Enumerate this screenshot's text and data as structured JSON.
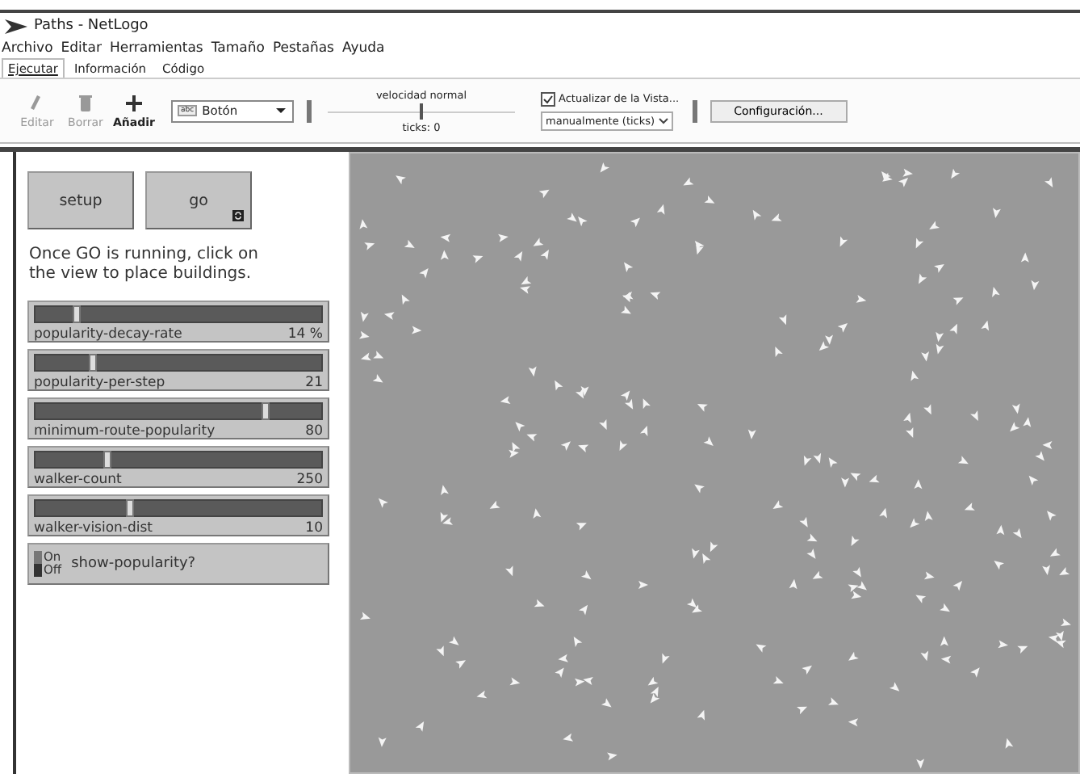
{
  "window": {
    "title": "Paths - NetLogo"
  },
  "menu": [
    "Archivo",
    "Editar",
    "Herramientas",
    "Tamaño",
    "Pestañas",
    "Ayuda"
  ],
  "tabs": [
    {
      "label": "Ejecutar",
      "selected": true
    },
    {
      "label": "Información",
      "selected": false
    },
    {
      "label": "Código",
      "selected": false
    }
  ],
  "toolbar": {
    "tools": [
      {
        "kind": "edit",
        "label": "Editar",
        "disabled": true
      },
      {
        "kind": "delete",
        "label": "Borrar",
        "disabled": true
      },
      {
        "kind": "add",
        "label": "Añadir",
        "disabled": false
      }
    ],
    "widget_type": {
      "badge": "abc",
      "value": "Botón"
    },
    "speed": {
      "label": "velocidad normal",
      "level": 0.5,
      "ticks": "ticks: 0"
    },
    "update": {
      "label": "Actualizar de la Vista...",
      "checked": true,
      "mode": "manualmente (ticks)"
    },
    "settings": "Configuración..."
  },
  "buttons": [
    {
      "label": "setup",
      "forever": false
    },
    {
      "label": "go",
      "forever": true
    }
  ],
  "note": "Once GO is running, click on the view to place buildings.",
  "sliders": [
    {
      "name": "popularity-decay-rate",
      "value": "14 %",
      "level": 0.14
    },
    {
      "name": "popularity-per-step",
      "value": "21",
      "level": 0.2
    },
    {
      "name": "minimum-route-popularity",
      "value": "80",
      "level": 0.8
    },
    {
      "name": "walker-count",
      "value": "250",
      "level": 0.25
    },
    {
      "name": "walker-vision-dist",
      "value": "10",
      "level": 0.33
    }
  ],
  "switch": {
    "label": "show-popularity?",
    "on": false,
    "on_text": "On",
    "off_text": "Off"
  }
}
